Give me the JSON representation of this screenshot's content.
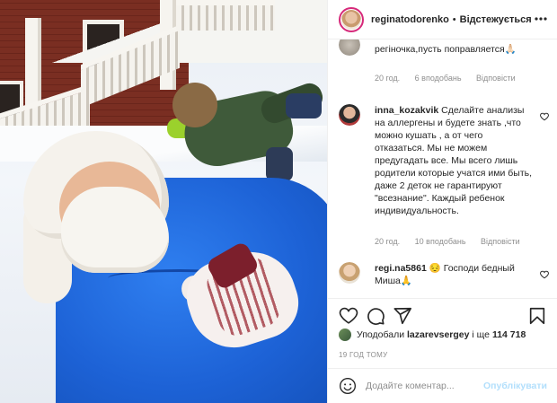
{
  "header": {
    "username": "reginatodorenko",
    "separator": "•",
    "follow_label": "Відстежується",
    "more_icon": "more-horizontal-icon"
  },
  "comments": [
    {
      "author": "",
      "text": "регіночка,пусть поправляется🙏🏻",
      "time": "20 год.",
      "likes": "6 вподобань",
      "reply": "Відповісти"
    },
    {
      "author": "inna_kozakvik",
      "text": "Сделайте анализы на аллергены и будете знать ,что можно кушать , а от чего отказаться. Мы не можем предугадать все. Мы всего лишь родители которые учатся ими быть, даже 2 деток не гарантируют \"всезнание\". Каждый ребенок индивидуальность.",
      "time": "20 год.",
      "likes": "10 вподобань",
      "reply": "Відповісти"
    },
    {
      "author": "regi.na5861",
      "text": "😔 Господи бедный Миша🙏",
      "time": "",
      "likes": "",
      "reply": ""
    }
  ],
  "actions": {
    "like_icon": "heart-icon",
    "comment_icon": "comment-icon",
    "share_icon": "paper-plane-icon",
    "save_icon": "bookmark-icon"
  },
  "likes_line": {
    "prefix": "Уподобали",
    "user": "lazarevsergey",
    "middle": "і ще",
    "count": "114 718"
  },
  "timestamp": "19 год тому",
  "add_comment": {
    "placeholder": "Додайте коментар...",
    "publish_label": "Опублікувати",
    "emoji_icon": "smiley-icon"
  },
  "colors": {
    "accent_blue": "#0095f6",
    "publish_disabled": "#b2dffc",
    "muted_text": "#8e8e8e",
    "story_ring": "#d6297a"
  }
}
